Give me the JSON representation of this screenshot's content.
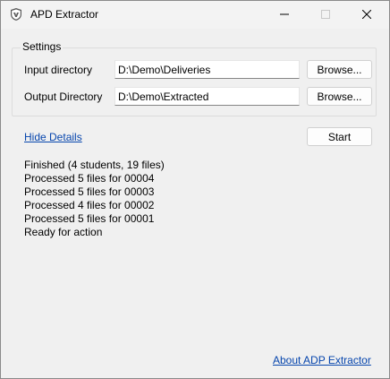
{
  "window": {
    "title": "APD Extractor",
    "icons": {
      "app": "shield-app-icon",
      "minimize": "minimize-icon",
      "maximize": "maximize-icon",
      "close": "close-icon"
    }
  },
  "settings": {
    "group_label": "Settings",
    "input": {
      "label": "Input directory",
      "value": "D:\\Demo\\Deliveries",
      "browse_label": "Browse..."
    },
    "output": {
      "label": "Output Directory",
      "value": "D:\\Demo\\Extracted",
      "browse_label": "Browse..."
    }
  },
  "actions": {
    "hide_details_label": "Hide Details",
    "start_label": "Start"
  },
  "log": [
    "Finished (4 students, 19 files)",
    "Processed 5 files for 00004",
    "Processed 5 files for 00003",
    "Processed 4 files for 00002",
    "Processed 5 files for 00001",
    "Ready for action"
  ],
  "footer": {
    "about_label": "About ADP Extractor"
  },
  "colors": {
    "link": "#0645ad",
    "background": "#f0f0f0",
    "input_bg": "#ffffff"
  }
}
